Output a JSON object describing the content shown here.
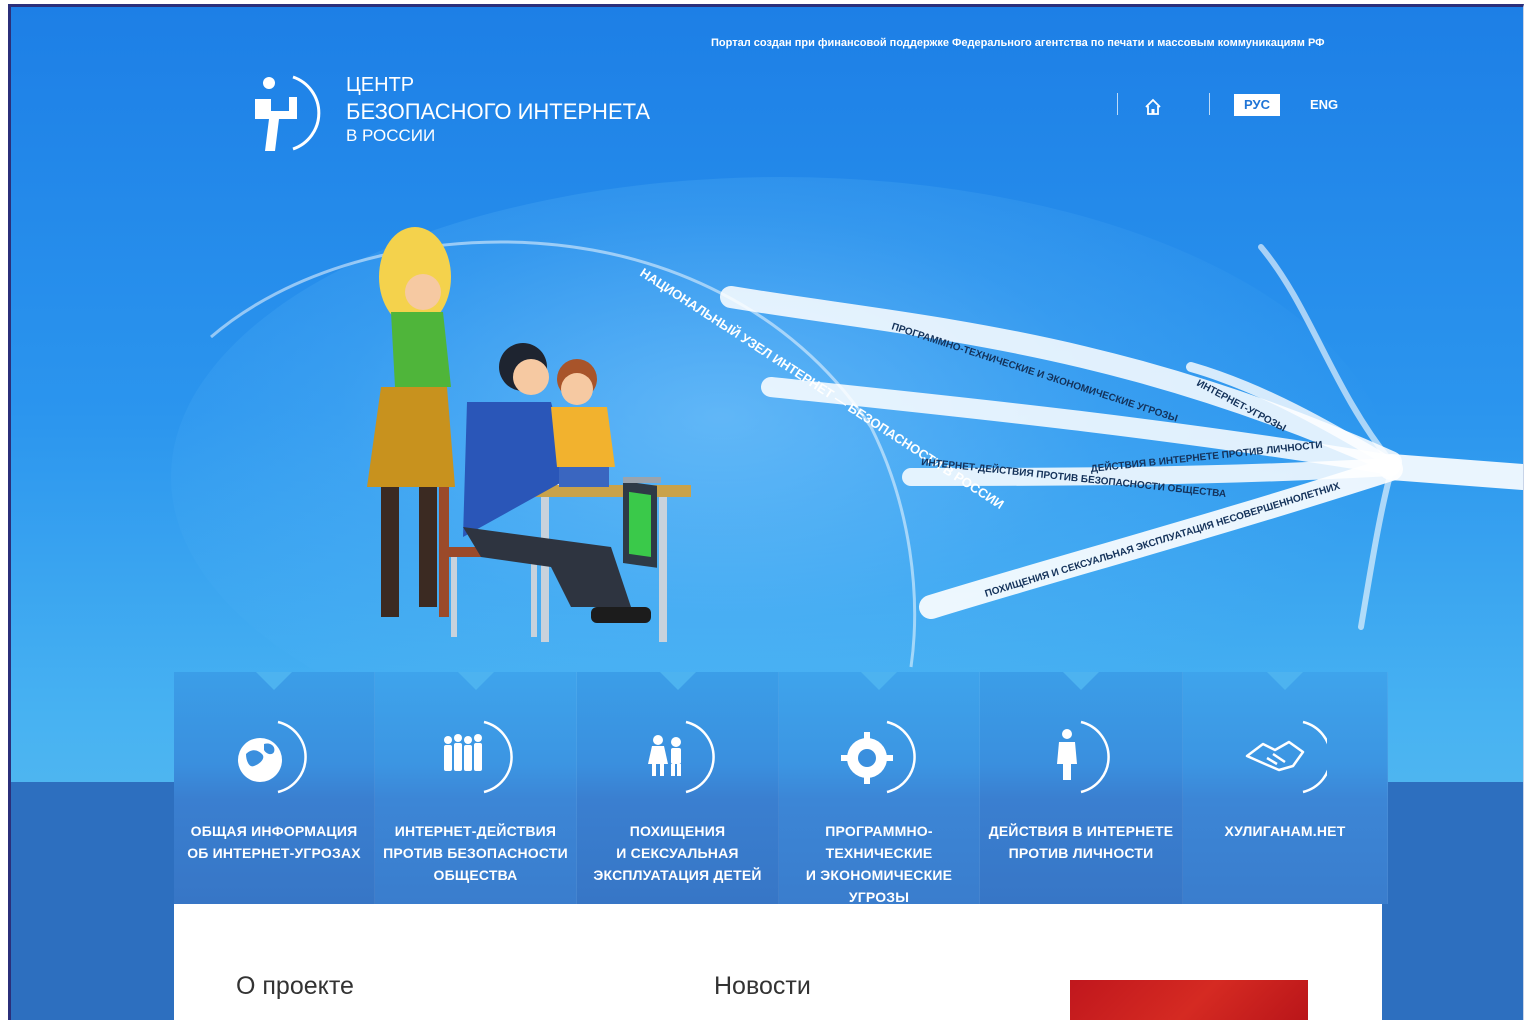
{
  "header": {
    "support_note": "Портал создан при финансовой поддержке Федерального агентства по печати и массовым коммуникациям РФ",
    "logo": {
      "line1": "ЦЕНТР",
      "line2": "БЕЗОПАСНОГО ИНТЕРНЕТА",
      "line3": "В РОССИИ"
    },
    "home_icon": "home-icon",
    "lang_ru": "РУС",
    "lang_en": "ENG"
  },
  "hero": {
    "arc_caption": "НАЦИОНАЛЬНЫЙ УЗЕЛ ИНТЕРНЕТ — БЕЗОПАСНОСТИ В РОССИИ",
    "strand_labels": [
      "ПРОГРАММНО-ТЕХНИЧЕСКИЕ И ЭКОНОМИЧЕСКИЕ УГРОЗЫ",
      "ИНТЕРНЕТ-УГРОЗЫ",
      "ДЕЙСТВИЯ В ИНТЕРНЕТЕ ПРОТИВ ЛИЧНОСТИ",
      "ИНТЕРНЕТ-ДЕЙСТВИЯ ПРОТИВ БЕЗОПАСНОСТИ ОБЩЕСТВА",
      "ПОХИЩЕНИЯ И СЕКСУАЛЬНАЯ ЭКСПЛУАТАЦИЯ НЕСОВЕРШЕННОЛЕТНИХ"
    ]
  },
  "nav": {
    "items": [
      {
        "icon": "globe-icon",
        "lines": [
          "ОБЩАЯ ИНФОРМАЦИЯ",
          "ОБ ИНТЕРНЕТ-УГРОЗАХ"
        ]
      },
      {
        "icon": "people-group-icon",
        "lines": [
          "ИНТЕРНЕТ-ДЕЙСТВИЯ",
          "ПРОТИВ БЕЗОПАСНОСТИ",
          "ОБЩЕСТВА"
        ]
      },
      {
        "icon": "children-icon",
        "lines": [
          "ПОХИЩЕНИЯ",
          "И СЕКСУАЛЬНАЯ",
          "ЭКСПЛУАТАЦИЯ ДЕТЕЙ"
        ]
      },
      {
        "icon": "gear-icon",
        "lines": [
          "ПРОГРАММНО-ТЕХНИЧЕСКИЕ",
          "И ЭКОНОМИЧЕСКИЕ",
          "УГРОЗЫ"
        ]
      },
      {
        "icon": "person-icon",
        "lines": [
          "ДЕЙСТВИЯ В ИНТЕРНЕТЕ",
          "ПРОТИВ ЛИЧНОСТИ"
        ]
      },
      {
        "icon": "handshake-icon",
        "lines": [
          "ХУЛИГАНАМ.НЕТ"
        ]
      }
    ]
  },
  "content": {
    "about_title": "О проекте",
    "news_title": "Новости"
  },
  "colors": {
    "sky_top": "#1d7fe6",
    "sky_bottom": "#4fb6f0",
    "band": "#2d6fbf",
    "lang_active_text": "#1f74d6"
  }
}
